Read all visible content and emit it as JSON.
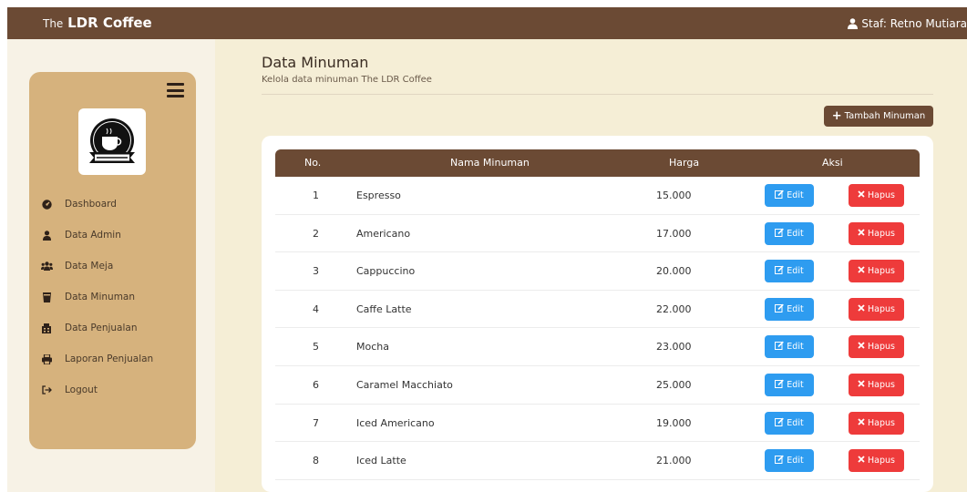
{
  "header": {
    "brand_prefix": "The",
    "brand_name": "LDR Coffee",
    "user_label": "Staf: Retno Mutiara"
  },
  "sidebar": {
    "logo_alt": "LDR Coffee logo",
    "items": [
      {
        "label": "Dashboard",
        "icon": "dashboard-icon"
      },
      {
        "label": "Data Admin",
        "icon": "user-icon"
      },
      {
        "label": "Data Meja",
        "icon": "users-icon"
      },
      {
        "label": "Data Minuman",
        "icon": "drink-icon"
      },
      {
        "label": "Data Penjualan",
        "icon": "receipt-icon"
      },
      {
        "label": "Laporan Penjualan",
        "icon": "print-icon"
      },
      {
        "label": "Logout",
        "icon": "logout-icon"
      }
    ]
  },
  "page": {
    "title": "Data Minuman",
    "subtitle": "Kelola data minuman The LDR Coffee",
    "add_button": "Tambah Minuman"
  },
  "table": {
    "headers": {
      "no": "No.",
      "name": "Nama Minuman",
      "price": "Harga",
      "action": "Aksi"
    },
    "edit_label": "Edit",
    "delete_label": "Hapus",
    "rows": [
      {
        "no": "1",
        "name": "Espresso",
        "price": "15.000"
      },
      {
        "no": "2",
        "name": "Americano",
        "price": "17.000"
      },
      {
        "no": "3",
        "name": "Cappuccino",
        "price": "20.000"
      },
      {
        "no": "4",
        "name": "Caffe Latte",
        "price": "22.000"
      },
      {
        "no": "5",
        "name": "Mocha",
        "price": "23.000"
      },
      {
        "no": "6",
        "name": "Caramel Macchiato",
        "price": "25.000"
      },
      {
        "no": "7",
        "name": "Iced Americano",
        "price": "19.000"
      },
      {
        "no": "8",
        "name": "Iced Latte",
        "price": "21.000"
      }
    ]
  },
  "colors": {
    "header_brown": "#6b4a34",
    "sidebar_tan": "#d6b27d",
    "background_cream": "#f5eed6",
    "edit_blue": "#2e9cf0",
    "delete_red": "#ee3b3b"
  }
}
